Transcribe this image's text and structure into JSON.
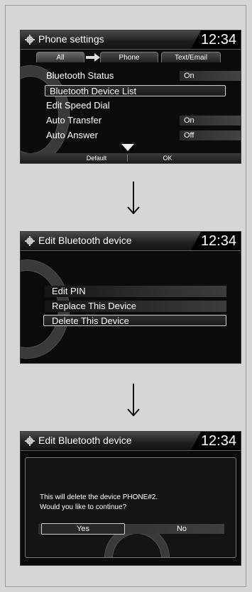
{
  "screen1": {
    "title": "Phone settings",
    "time": "12:34",
    "tabs": [
      "All",
      "Phone",
      "Text/Email"
    ],
    "items": [
      {
        "label": "Bluetooth Status",
        "value": "On"
      },
      {
        "label": "Bluetooth Device List",
        "value": ""
      },
      {
        "label": "Edit Speed Dial",
        "value": ""
      },
      {
        "label": "Auto Transfer",
        "value": "On"
      },
      {
        "label": "Auto Answer",
        "value": "Off"
      }
    ],
    "bottom": {
      "default_label": "Default",
      "ok_label": "OK"
    }
  },
  "screen2": {
    "title": "Edit Bluetooth device",
    "time": "12:34",
    "items": [
      "Edit PIN",
      "Replace This Device",
      "Delete This Device"
    ]
  },
  "screen3": {
    "title": "Edit Bluetooth device",
    "time": "12:34",
    "message_line1": "This will delete the device PHONE#2.",
    "message_line2": "Would you like to continue?",
    "yes_label": "Yes",
    "no_label": "No"
  },
  "colors": {
    "screen_bg": "#0b0b0b",
    "page_bg": "#d6d6d6",
    "text": "#ffffff"
  },
  "icons": [
    "settings-gear-icon",
    "down-arrow-icon",
    "tab-arrow-icon"
  ]
}
